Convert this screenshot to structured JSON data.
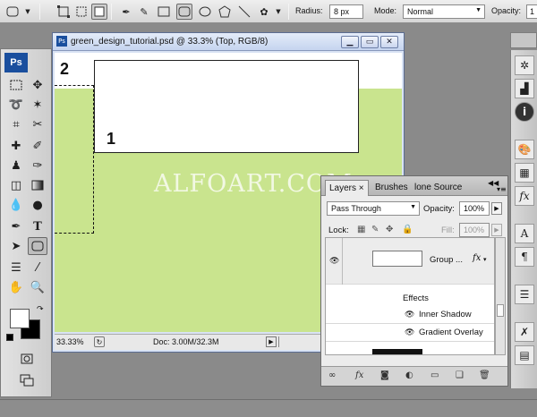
{
  "options_bar": {
    "radius_label": "Radius:",
    "radius_value": "8 px",
    "mode_label": "Mode:",
    "mode_value": "Normal",
    "opacity_label": "Opacity:",
    "opacity_value": "1"
  },
  "toolbox": {
    "logo": "Ps"
  },
  "document": {
    "title": "green_design_tutorial.psd @ 33.3% (Top, RGB/8)",
    "label_one": "1",
    "label_two": "2",
    "zoom": "33.33%",
    "doc_info": "Doc: 3.00M/32.3M"
  },
  "watermark": "ALFOART.COM",
  "layers_panel": {
    "tabs": [
      "Layers ×",
      "Brushes",
      "lone Source"
    ],
    "blend_mode": "Pass Through",
    "opacity_label": "Opacity:",
    "opacity_value": "100%",
    "lock_label": "Lock:",
    "fill_label": "Fill:",
    "fill_value": "100%",
    "group_name": "Group ...",
    "effects_label": "Effects",
    "effects": [
      "Inner Shadow",
      "Gradient Overlay"
    ]
  },
  "colors": {
    "canvas_green": "#c9e48e",
    "titlebar_blue": "#c5d4ef",
    "ps_logo_blue": "#1a4f9e"
  }
}
